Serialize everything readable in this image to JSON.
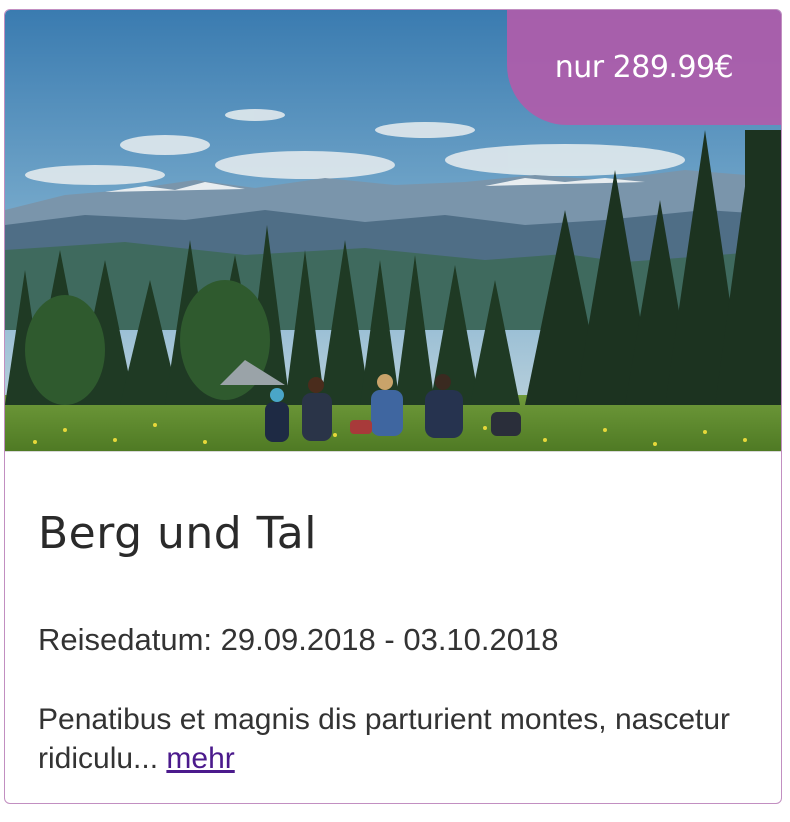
{
  "card": {
    "price": "nur 289.99€",
    "title": "Berg und Tal",
    "date": "Reisedatum: 29.09.2018 - 03.10.2018",
    "description": "Penatibus et magnis dis parturient montes, nascetur ridiculu...",
    "more_link": "mehr"
  },
  "colors": {
    "accent": "#b05caa",
    "border": "#c28fc1",
    "link": "#4b1a8c"
  }
}
